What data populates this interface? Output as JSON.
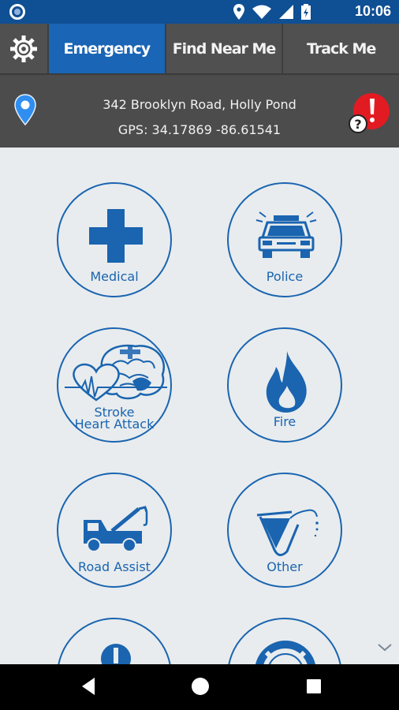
{
  "status_bar": {
    "time": "10:06",
    "icons": [
      "app-notification-icon",
      "location-icon",
      "wifi-icon",
      "signal-icon",
      "battery-icon"
    ]
  },
  "nav": {
    "settings_icon": "gear-icon",
    "tabs": [
      {
        "label": "Emergency",
        "active": true
      },
      {
        "label": "Find Near Me",
        "active": false
      },
      {
        "label": "Track Me",
        "active": false
      }
    ]
  },
  "location": {
    "address": "342 Brooklyn Road, Holly Pond",
    "gps": "GPS: 34.17869 -86.61541"
  },
  "services": {
    "medical": "Medical",
    "police": "Police",
    "stroke_line1": "Stroke",
    "stroke_line2": "Heart Attack",
    "fire": "Fire",
    "road_assist": "Road Assist",
    "other": "Other"
  },
  "colors": {
    "status_bar": "#0f4f94",
    "accent": "#1a65b5",
    "nav_bg": "#505050",
    "location_bg": "#4c4c4c",
    "alert": "#e21b23",
    "background": "#e8ecee"
  }
}
